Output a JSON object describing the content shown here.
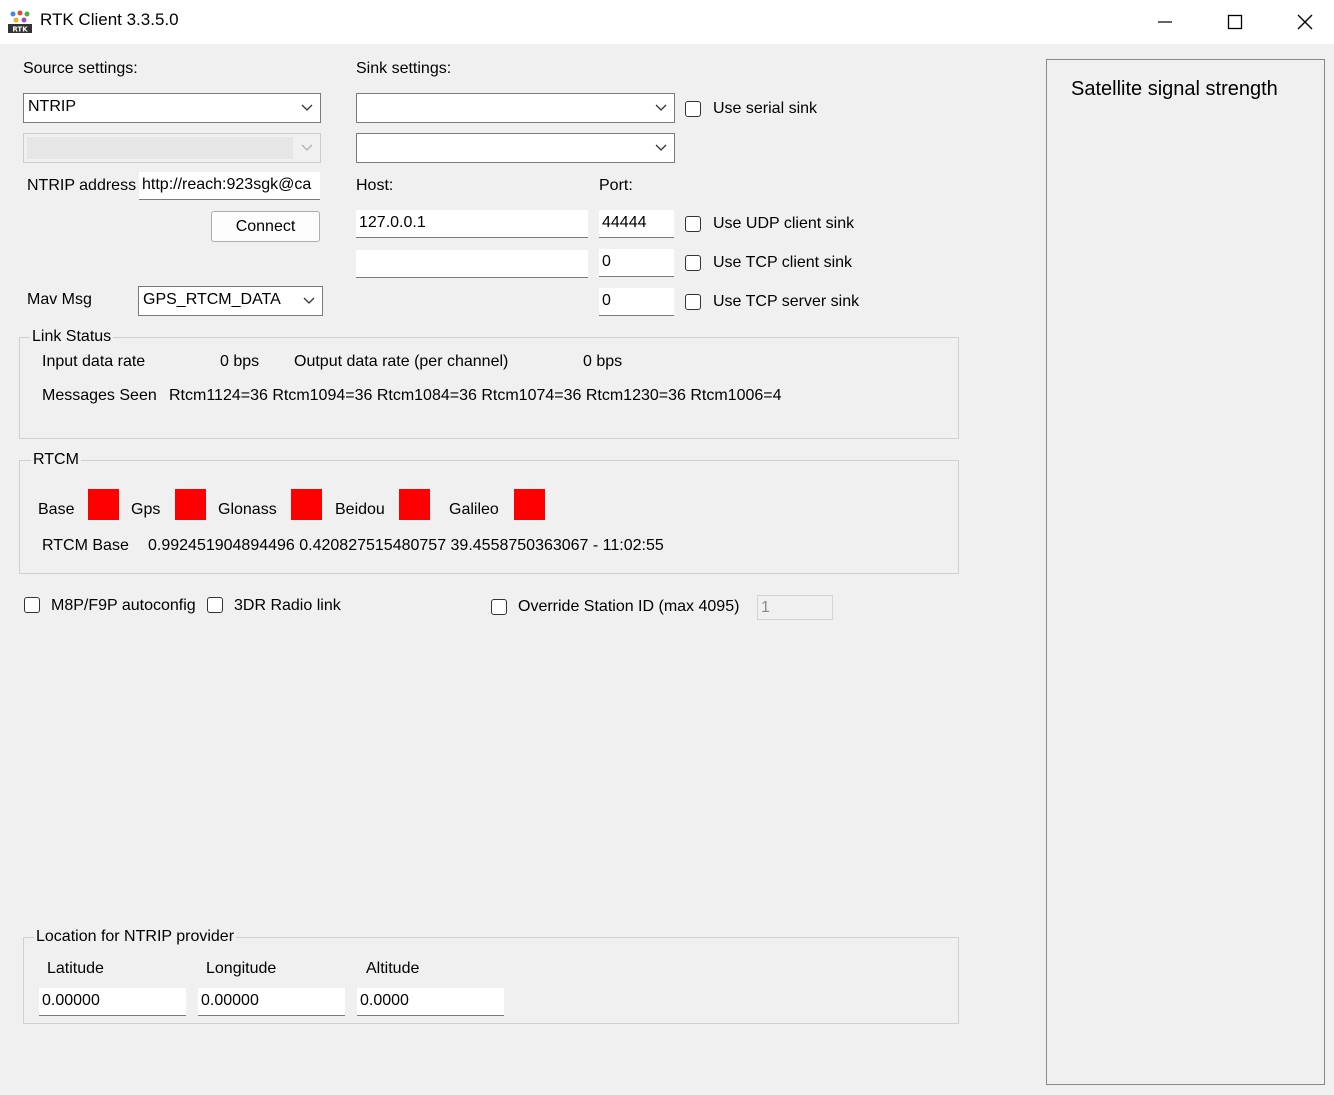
{
  "window": {
    "title": "RTK Client 3.3.5.0"
  },
  "source": {
    "label": "Source settings:",
    "type_selected": "NTRIP",
    "sub_selected": "",
    "ntrip_label": "NTRIP address",
    "ntrip_value": "http://reach:923sgk@ca",
    "connect_label": "Connect",
    "mavmsg_label": "Mav Msg",
    "mavmsg_selected": "GPS_RTCM_DATA"
  },
  "sink": {
    "label": "Sink settings:",
    "serial_selected": "",
    "baud_selected": "",
    "use_serial_label": "Use serial sink",
    "host_label": "Host:",
    "port_label": "Port:",
    "udp_host": "127.0.0.1",
    "udp_port": "44444",
    "use_udp_label": "Use UDP client sink",
    "tcp_host": "",
    "tcp_port": "0",
    "use_tcp_client_label": "Use TCP client sink",
    "tcp_server_port": "0",
    "use_tcp_server_label": "Use TCP server sink"
  },
  "link_status": {
    "title": "Link Status",
    "input_label": "Input data rate",
    "input_value": "0 bps",
    "output_label": "Output data rate (per channel)",
    "output_value": "0 bps",
    "messages_label": "Messages Seen",
    "messages_value": "Rtcm1124=36 Rtcm1094=36 Rtcm1084=36 Rtcm1074=36 Rtcm1230=36 Rtcm1006=4"
  },
  "rtcm": {
    "title": "RTCM",
    "indicators": [
      {
        "label": "Base",
        "color": "#ff0000"
      },
      {
        "label": "Gps",
        "color": "#ff0000"
      },
      {
        "label": "Glonass",
        "color": "#ff0000"
      },
      {
        "label": "Beidou",
        "color": "#ff0000"
      },
      {
        "label": "Galileo",
        "color": "#ff0000"
      }
    ],
    "base_label": "RTCM Base",
    "base_value": "0.992451904894496 0.420827515480757 39.4558750363067 - 11:02:55"
  },
  "options": {
    "autoconfig_label": "M8P/F9P autoconfig",
    "radio_label": "3DR Radio link",
    "override_label": "Override Station ID (max 4095)",
    "station_id": "1"
  },
  "location": {
    "title": "Location for NTRIP provider",
    "lat_label": "Latitude",
    "lon_label": "Longitude",
    "alt_label": "Altitude",
    "lat_value": "0.00000",
    "lon_value": "0.00000",
    "alt_value": "0.0000"
  },
  "satellite": {
    "title": "Satellite signal strength"
  }
}
